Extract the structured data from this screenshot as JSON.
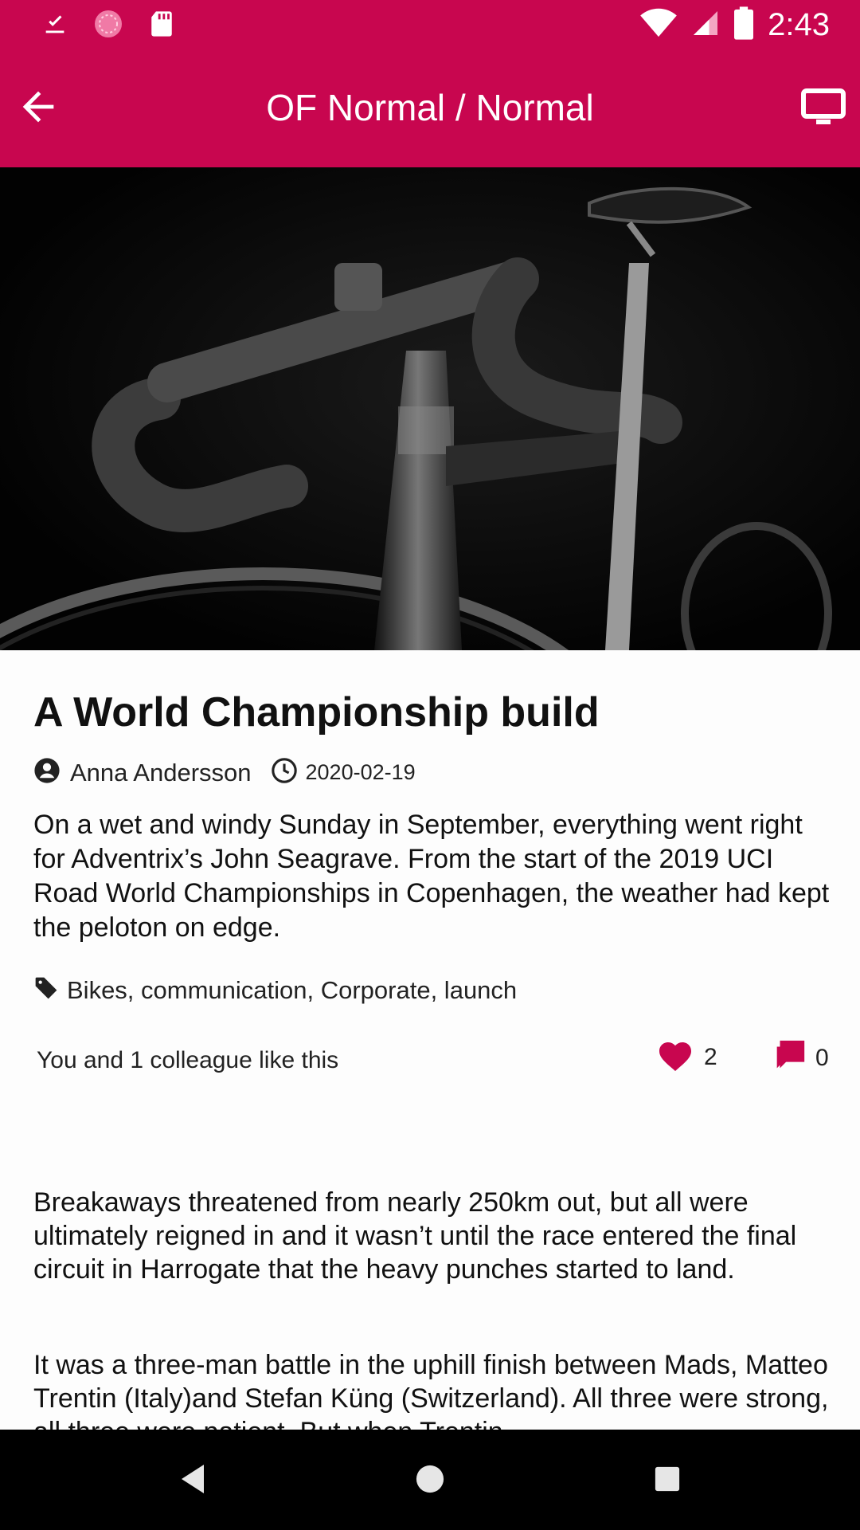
{
  "status_bar": {
    "time": "2:43",
    "icons": [
      "download-done-icon",
      "sync-icon",
      "sd-card-icon",
      "wifi-icon",
      "signal-icon",
      "battery-icon"
    ]
  },
  "app_bar": {
    "title": "OF Normal / Normal",
    "back_icon": "arrow-back-icon",
    "action_icon": "tv-icon",
    "color": "#c8064f"
  },
  "article": {
    "hero_image": "bicycle-photo",
    "title": "A World Championship build",
    "author": "Anna Andersson",
    "date": "2020-02-19",
    "lead": "On a wet and windy Sunday in September, everything went right for Adventrix’s John Seagrave. From the start of the 2019 UCI Road World Championships in Copenhagen, the weather had kept the peloton on edge.",
    "tags": "Bikes, communication, Corporate, launch",
    "likes_text": "You and 1 colleague like this",
    "like_count": "2",
    "comment_count": "0",
    "paragraphs": [
      "Breakaways threatened from nearly 250km out, but all were ultimately reigned in and it wasn’t until the race entered the final circuit in Harrogate that the heavy punches started to land.",
      "It was a three-man battle in the uphill finish between Mads, Matteo Trentin (Italy)and Stefan Küng (Switzerland). All three were strong, all three were patient. But when Trentin"
    ]
  },
  "nav_bar": {
    "back_icon": "nav-back-icon",
    "home_icon": "nav-home-icon",
    "recents_icon": "nav-recents-icon"
  }
}
